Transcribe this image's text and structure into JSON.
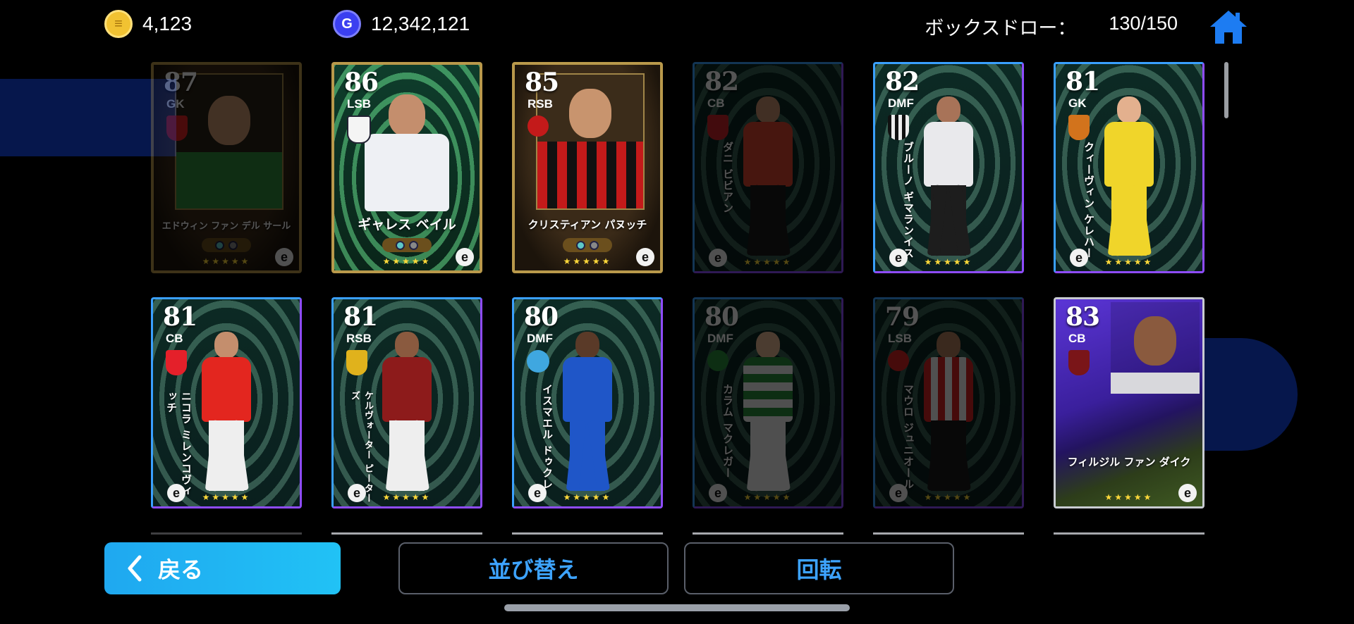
{
  "header": {
    "coins": "4,123",
    "gp": "12,342,121",
    "box_draw_label": "ボックスドロー：",
    "box_draw_count": "130/150"
  },
  "icons": {
    "coin": "coin-icon",
    "gp": "gp-icon",
    "home": "home-icon",
    "back": "chevron-left-icon"
  },
  "colors": {
    "accent_blue": "#3da3ff",
    "back_button": "#1fa8f0",
    "star": "#ffd93a"
  },
  "cards": [
    {
      "rating": "87",
      "position": "GK",
      "name": "エドウィン ファン デル サール",
      "dim": true
    },
    {
      "rating": "86",
      "position": "LSB",
      "name": "ギャレス ベイル",
      "dim": false
    },
    {
      "rating": "85",
      "position": "RSB",
      "name": "クリスティアン パヌッチ",
      "dim": false
    },
    {
      "rating": "82",
      "position": "CB",
      "name": "ダニ ビビアン",
      "dim": true
    },
    {
      "rating": "82",
      "position": "DMF",
      "name": "ブルーノ ギマランイス",
      "dim": false
    },
    {
      "rating": "81",
      "position": "GK",
      "name": "クィーヴィン ケレハー",
      "dim": false
    },
    {
      "rating": "81",
      "position": "CB",
      "name": "ニコラ ミレンコヴィッチ",
      "dim": false
    },
    {
      "rating": "81",
      "position": "RSB",
      "name": "ケルヴォーター ピーターズ",
      "dim": false
    },
    {
      "rating": "80",
      "position": "DMF",
      "name": "イスマエル ドゥクレ",
      "dim": false
    },
    {
      "rating": "80",
      "position": "DMF",
      "name": "カラム マクレガー",
      "dim": true
    },
    {
      "rating": "79",
      "position": "LSB",
      "name": "マウロ ジュニオール",
      "dim": true
    },
    {
      "rating": "83",
      "position": "CB",
      "name": "フィルジル ファン ダイク",
      "dim": false
    }
  ],
  "stars": "★★★★★",
  "e_logo": "e",
  "buttons": {
    "back": "戻る",
    "sort": "並び替え",
    "rotate": "回転"
  }
}
